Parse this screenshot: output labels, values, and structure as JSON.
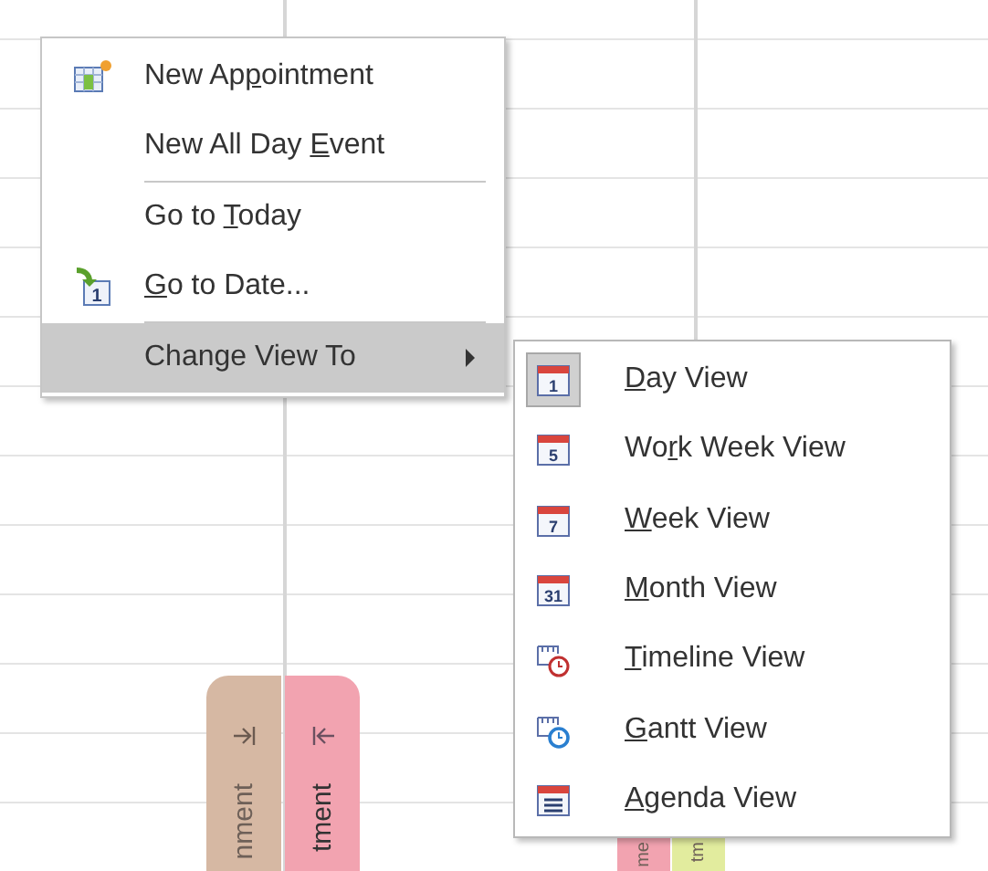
{
  "calendar": {
    "tabs": [
      {
        "text": "nment",
        "color": "#d6b8a3",
        "kind": "to-end",
        "faded": true
      },
      {
        "text": "tment",
        "color": "#f2a3b0",
        "kind": "to-start",
        "faded": false
      }
    ],
    "bottom_tabs": [
      {
        "text": "me",
        "color": "#f2a3b0"
      },
      {
        "text": "tm",
        "color": "#e2ec9e"
      }
    ]
  },
  "context_menu": {
    "items": [
      {
        "kind": "item",
        "before": "New Ap",
        "key": "p",
        "after": "ointment",
        "highlighted": false,
        "submenu": false
      },
      {
        "kind": "item",
        "before": "New All Day ",
        "key": "E",
        "after": "vent",
        "highlighted": false,
        "submenu": false
      },
      {
        "kind": "separator"
      },
      {
        "kind": "item",
        "before": "Go to ",
        "key": "T",
        "after": "oday",
        "highlighted": false,
        "submenu": false
      },
      {
        "kind": "item",
        "icon_text": "1",
        "key": "G",
        "after": "o to Date...",
        "highlighted": false,
        "submenu": false
      },
      {
        "kind": "separator"
      },
      {
        "kind": "item",
        "before": "Change View To",
        "highlighted": true,
        "submenu": true
      }
    ]
  },
  "submenu": {
    "items": [
      {
        "icon_text": "1",
        "key": "D",
        "after": "ay View",
        "checked": true
      },
      {
        "icon_text": "5",
        "before": "Wo",
        "key": "r",
        "after": "k Week View",
        "checked": false
      },
      {
        "icon_text": "7",
        "key": "W",
        "after": "eek View",
        "checked": false
      },
      {
        "icon_text": "31",
        "key": "M",
        "after": "onth View",
        "checked": false
      },
      {
        "key": "T",
        "after": "imeline View",
        "checked": false
      },
      {
        "key": "G",
        "after": "antt View",
        "checked": false
      },
      {
        "key": "A",
        "after": "genda View",
        "checked": false
      }
    ]
  }
}
